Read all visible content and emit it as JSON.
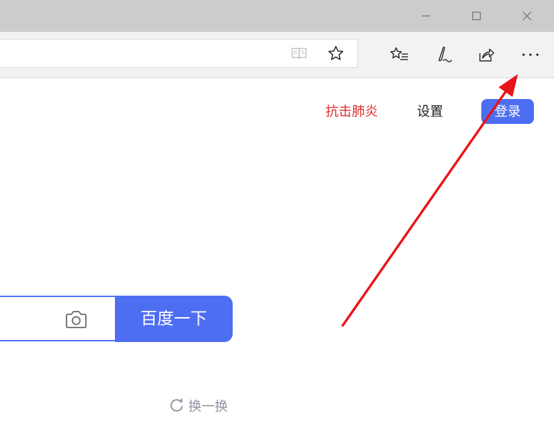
{
  "nav": {
    "covid_link": "抗击肺炎",
    "settings_link": "设置",
    "login_label": "登录"
  },
  "search": {
    "button_label": "百度一下"
  },
  "hotlist": {
    "refresh_label": "换一换"
  },
  "colors": {
    "titlebar": "#cccccc",
    "toolbar": "#f2f2f2",
    "brand_blue": "#4e6ef2",
    "covid_red": "#e02d2d",
    "annotation_red": "#e8141a"
  }
}
